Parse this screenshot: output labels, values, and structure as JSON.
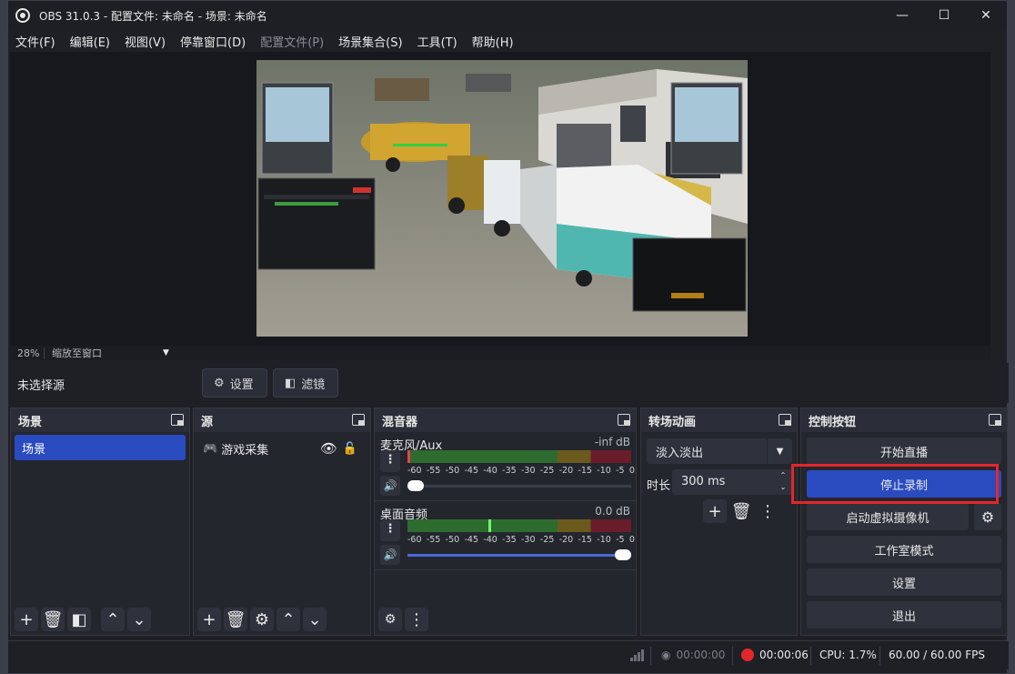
{
  "window": {
    "title": "OBS 31.0.3 - 配置文件: 未命名 - 场景: 未命名",
    "minimize": "—",
    "maximize": "☐",
    "close": "✕"
  },
  "menu": [
    {
      "label": "文件(F)",
      "disabled": false
    },
    {
      "label": "编辑(E)",
      "disabled": false
    },
    {
      "label": "视图(V)",
      "disabled": false
    },
    {
      "label": "停靠窗口(D)",
      "disabled": false
    },
    {
      "label": "配置文件(P)",
      "disabled": true
    },
    {
      "label": "场景集合(S)",
      "disabled": false
    },
    {
      "label": "工具(T)",
      "disabled": false
    },
    {
      "label": "帮助(H)",
      "disabled": false
    }
  ],
  "zoom": {
    "percent": "28%",
    "mode": "缩放至窗口"
  },
  "source_toolbar": {
    "no_source": "未选择源",
    "settings": "设置",
    "filters": "滤镜"
  },
  "docks": {
    "scenes": {
      "title": "场景",
      "items": [
        "场景"
      ]
    },
    "sources": {
      "title": "源",
      "items": [
        {
          "name": "游戏采集"
        }
      ]
    },
    "mixer": {
      "title": "混音器",
      "channels": [
        {
          "name": "麦克风/Aux",
          "db": "-inf dB",
          "level": 0,
          "volume": 0.05
        },
        {
          "name": "桌面音频",
          "db": "0.0 dB",
          "level": 0.36,
          "volume": 1.0
        }
      ],
      "ticks": [
        "-60",
        "-55",
        "-50",
        "-45",
        "-40",
        "-35",
        "-30",
        "-25",
        "-20",
        "-15",
        "-10",
        "-5",
        "0"
      ]
    },
    "transitions": {
      "title": "转场动画",
      "selected": "淡入淡出",
      "duration_label": "时长",
      "duration": "300 ms"
    },
    "controls": {
      "title": "控制按钮",
      "start_stream": "开始直播",
      "stop_record": "停止录制",
      "virtual_cam": "启动虚拟摄像机",
      "studio_mode": "工作室模式",
      "settings": "设置",
      "exit": "退出"
    }
  },
  "status": {
    "stream_time": "00:00:00",
    "record_time": "00:00:06",
    "cpu": "CPU: 1.7%",
    "fps": "60.00 / 60.00 FPS"
  },
  "colors": {
    "accent": "#2a4bbf",
    "record": "#e3262a",
    "highlight": "#e3262a"
  }
}
